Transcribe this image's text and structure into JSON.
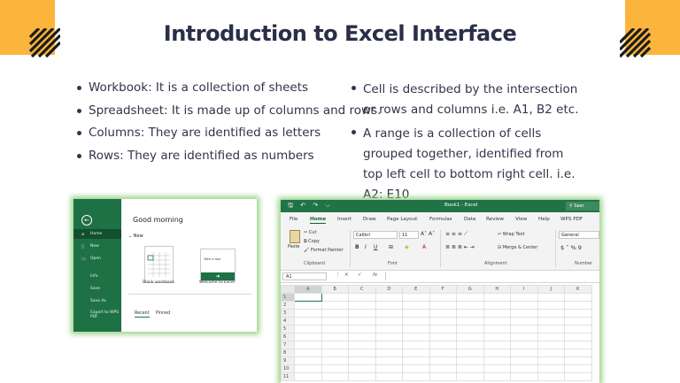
{
  "slide": {
    "title": "Introduction to Excel Interface",
    "accent_color": "#fbb43c",
    "left_bullets": [
      "Workbook: It is a collection of sheets",
      "Spreadsheet: It is made up of columns and rows.",
      "Columns: They are identified as letters",
      "Rows: They are identified as numbers"
    ],
    "right_bullets": [
      "Cell is described by the intersection or rows and columns i.e. A1, B2 etc.",
      "A range is a collection of cells grouped together, identified from top left cell to bottom right cell. i.e. A2: E10"
    ]
  },
  "backstage": {
    "nav": [
      {
        "label": "Home",
        "icon": "home-icon"
      },
      {
        "label": "New",
        "icon": "new-file-icon"
      },
      {
        "label": "Open",
        "icon": "folder-open-icon"
      },
      {
        "label": "Info",
        "icon": ""
      },
      {
        "label": "Save",
        "icon": ""
      },
      {
        "label": "Save As",
        "icon": ""
      },
      {
        "label": "Export to WPS PDF",
        "icon": ""
      }
    ],
    "greeting": "Good morning",
    "new_section": "New",
    "blank_workbook": "Blank workbook",
    "tour_card_text": "Take a tour",
    "tour_card_label": "Welcome to Excel",
    "tabs": [
      "Recent",
      "Pinned"
    ],
    "brand_color": "#1e7145"
  },
  "excel": {
    "window_title": "Book1  -  Excel",
    "search_label": "Sear",
    "tabs": [
      "File",
      "Home",
      "Insert",
      "Draw",
      "Page Layout",
      "Formulas",
      "Data",
      "Review",
      "View",
      "Help",
      "WPS PDF"
    ],
    "active_tab": "Home",
    "clipboard": {
      "paste": "Paste",
      "cut": "Cut",
      "copy": "Copy",
      "format_painter": "Format Painter",
      "group": "Clipboard"
    },
    "font": {
      "name": "Calibri",
      "size": "11",
      "group": "Font"
    },
    "alignment": {
      "wrap_text": "Wrap Text",
      "merge_center": "Merge & Center",
      "group": "Alignment"
    },
    "number": {
      "format": "General",
      "group": "Number"
    },
    "name_box": "A1",
    "fx": "fx",
    "columns": [
      "A",
      "B",
      "C",
      "D",
      "E",
      "F",
      "G",
      "H",
      "I",
      "J",
      "K"
    ],
    "rows": [
      "1",
      "2",
      "3",
      "4",
      "5",
      "6",
      "7",
      "8",
      "9",
      "10",
      "11"
    ],
    "brand_color": "#217346"
  }
}
